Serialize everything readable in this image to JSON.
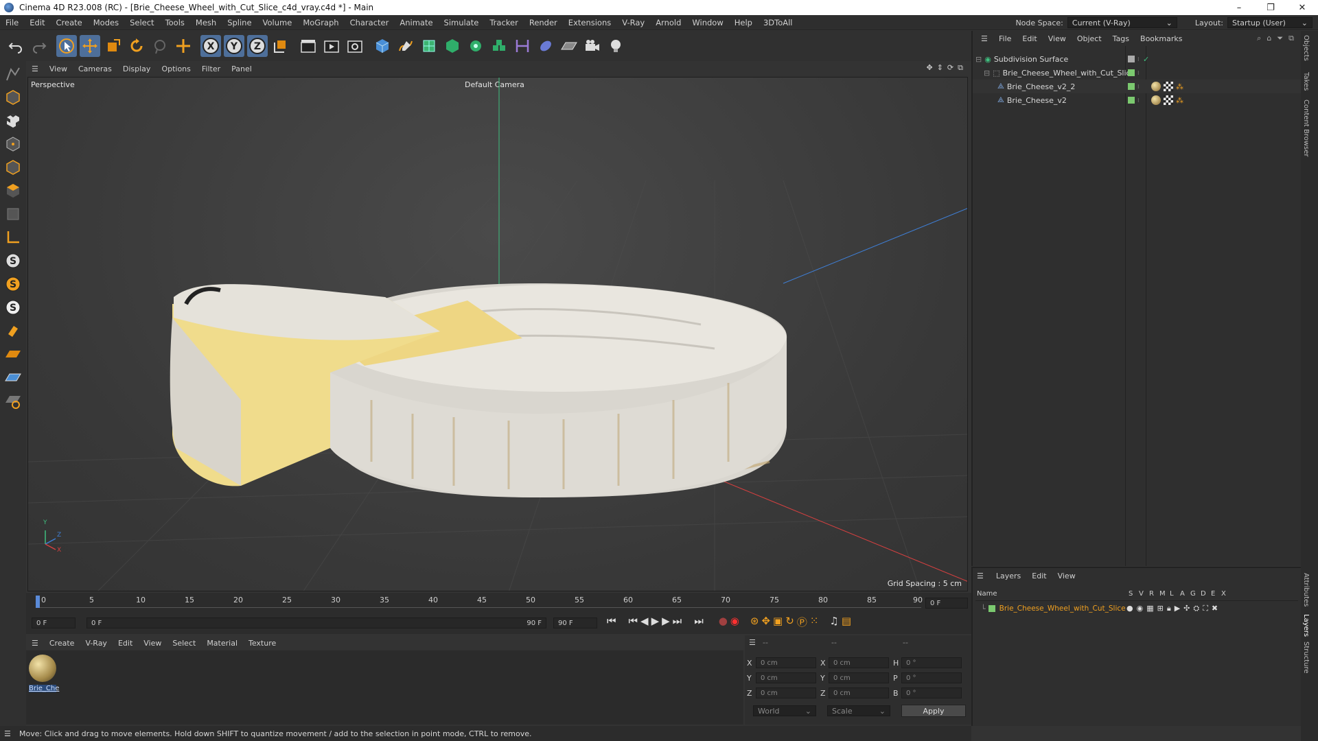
{
  "window": {
    "title": "Cinema 4D R23.008 (RC) - [Brie_Cheese_Wheel_with_Cut_Slice_c4d_vray.c4d *] - Main",
    "minimize": "–",
    "maximize": "❐",
    "close": "✕"
  },
  "menubar": {
    "items": [
      "File",
      "Edit",
      "Create",
      "Modes",
      "Select",
      "Tools",
      "Mesh",
      "Spline",
      "Volume",
      "MoGraph",
      "Character",
      "Animate",
      "Simulate",
      "Tracker",
      "Render",
      "Extensions",
      "V-Ray",
      "Arnold",
      "Window",
      "Help",
      "3DToAll"
    ],
    "node_space_label": "Node Space:",
    "node_space_value": "Current (V-Ray)",
    "layout_label": "Layout:",
    "layout_value": "Startup (User)"
  },
  "viewport": {
    "menu": [
      "View",
      "Cameras",
      "Display",
      "Options",
      "Filter",
      "Panel"
    ],
    "view_name": "Perspective",
    "camera_name": "Default Camera",
    "grid_spacing": "Grid Spacing : 5 cm",
    "axis_y": "Y",
    "axis_z": "Z",
    "axis_x": "X"
  },
  "timeline": {
    "ticks": [
      "0",
      "5",
      "10",
      "15",
      "20",
      "25",
      "30",
      "35",
      "40",
      "45",
      "50",
      "55",
      "60",
      "65",
      "70",
      "75",
      "80",
      "85",
      "90"
    ],
    "end_frame_field": "0 F",
    "start_field": "0 F",
    "range_start": "0 F",
    "range_end": "90 F",
    "max_field": "90 F"
  },
  "material_manager": {
    "menu": [
      "Create",
      "V-Ray",
      "Edit",
      "View",
      "Select",
      "Material",
      "Texture"
    ],
    "material_name": "Brie_Che"
  },
  "coordinates": {
    "headers": [
      "--",
      "--",
      "--"
    ],
    "rows": [
      {
        "a": "X",
        "av": "0 cm",
        "b": "X",
        "bv": "0 cm",
        "c": "H",
        "cv": "0 °"
      },
      {
        "a": "Y",
        "av": "0 cm",
        "b": "Y",
        "bv": "0 cm",
        "c": "P",
        "cv": "0 °"
      },
      {
        "a": "Z",
        "av": "0 cm",
        "b": "Z",
        "bv": "0 cm",
        "c": "B",
        "cv": "0 °"
      }
    ],
    "world": "World",
    "scale": "Scale",
    "apply": "Apply"
  },
  "status": {
    "text": "Move: Click and drag to move elements. Hold down SHIFT to quantize movement / add to the selection in point mode, CTRL to remove."
  },
  "objects": {
    "menu": [
      "File",
      "Edit",
      "View",
      "Object",
      "Tags",
      "Bookmarks"
    ],
    "items": [
      {
        "name": "Subdivision Surface",
        "indent": 0
      },
      {
        "name": "Brie_Cheese_Wheel_with_Cut_Slice",
        "indent": 1
      },
      {
        "name": "Brie_Cheese_v2_2",
        "indent": 2
      },
      {
        "name": "Brie_Cheese_v2",
        "indent": 2
      }
    ]
  },
  "layers": {
    "menu": [
      "Layers",
      "Edit",
      "View"
    ],
    "name_header": "Name",
    "flag_headers": [
      "S",
      "V",
      "R",
      "M",
      "L",
      "A",
      "G",
      "D",
      "E",
      "X"
    ],
    "layer_name": "Brie_Cheese_Wheel_with_Cut_Slice",
    "layer_color": "#7bc96f"
  },
  "side_tabs": [
    "Objects",
    "Takes",
    "Content Browser",
    "Attributes",
    "Layers",
    "Structure"
  ]
}
